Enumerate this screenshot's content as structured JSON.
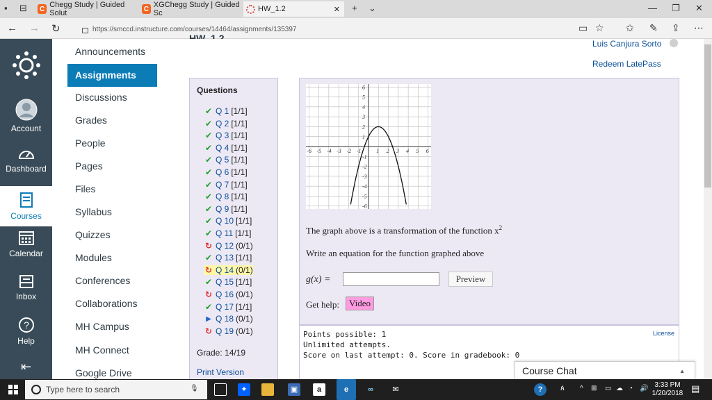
{
  "browser": {
    "tabs": [
      {
        "title": "Chegg Study | Guided Solut",
        "icon": "chegg-icon"
      },
      {
        "title": "XGChegg Study | Guided Sc",
        "icon": "chegg-icon"
      },
      {
        "title": "HW_1.2",
        "icon": "loading-ring-icon"
      }
    ],
    "url": "https://smccd.instructure.com/courses/14464/assignments/135397"
  },
  "global_nav": [
    {
      "label": "",
      "icon": "canvas-logo-icon"
    },
    {
      "label": "Account",
      "icon": "avatar-icon"
    },
    {
      "label": "Dashboard",
      "icon": "dashboard-icon"
    },
    {
      "label": "Courses",
      "icon": "courses-icon"
    },
    {
      "label": "Calendar",
      "icon": "calendar-icon"
    },
    {
      "label": "Inbox",
      "icon": "inbox-icon"
    },
    {
      "label": "Help",
      "icon": "help-icon"
    }
  ],
  "course_nav": {
    "active": "Assignments",
    "items": [
      "Announcements",
      "Discussions",
      "Grades",
      "People",
      "Pages",
      "Files",
      "Syllabus",
      "Quizzes",
      "Modules",
      "Conferences",
      "Collaborations",
      "MH Campus",
      "MH Connect",
      "Google Drive"
    ]
  },
  "page": {
    "title": "HW_1.2",
    "user": "Luis Canjura Sorto",
    "redeem": "Redeem LatePass"
  },
  "questions": {
    "header": "Questions",
    "items": [
      {
        "label": "Q 1",
        "score": "[1/1]",
        "status": "ok"
      },
      {
        "label": "Q 2",
        "score": "[1/1]",
        "status": "ok"
      },
      {
        "label": "Q 3",
        "score": "[1/1]",
        "status": "ok"
      },
      {
        "label": "Q 4",
        "score": "[1/1]",
        "status": "ok"
      },
      {
        "label": "Q 5",
        "score": "[1/1]",
        "status": "ok"
      },
      {
        "label": "Q 6",
        "score": "[1/1]",
        "status": "ok"
      },
      {
        "label": "Q 7",
        "score": "[1/1]",
        "status": "ok"
      },
      {
        "label": "Q 8",
        "score": "[1/1]",
        "status": "ok"
      },
      {
        "label": "Q 9",
        "score": "[1/1]",
        "status": "ok"
      },
      {
        "label": "Q 10",
        "score": "[1/1]",
        "status": "ok"
      },
      {
        "label": "Q 11",
        "score": "[1/1]",
        "status": "ok"
      },
      {
        "label": "Q 12",
        "score": "(0/1)",
        "status": "retry"
      },
      {
        "label": "Q 13",
        "score": "[1/1]",
        "status": "ok"
      },
      {
        "label": "Q 14",
        "score": "(0/1)",
        "status": "retry-current"
      },
      {
        "label": "Q 15",
        "score": "[1/1]",
        "status": "ok"
      },
      {
        "label": "Q 16",
        "score": "(0/1)",
        "status": "retry"
      },
      {
        "label": "Q 17",
        "score": "[1/1]",
        "status": "ok"
      },
      {
        "label": "Q 18",
        "score": "(0/1)",
        "status": "unattempted"
      },
      {
        "label": "Q 19",
        "score": "(0/1)",
        "status": "retry"
      }
    ],
    "grade": "Grade: 14/19",
    "print": "Print Version"
  },
  "problem": {
    "graph_ticks_x": [
      "-6",
      "-5",
      "-4",
      "-3",
      "-2",
      "-1",
      "1",
      "2",
      "3",
      "4",
      "5",
      "6"
    ],
    "graph_ticks_y": [
      "6",
      "5",
      "4",
      "3",
      "2",
      "1",
      "-1",
      "-2",
      "-3",
      "-4",
      "-5",
      "-6"
    ],
    "parabola": {
      "vertex": [
        1,
        2
      ],
      "a": -1
    },
    "prompt1": "The graph above is a transformation of the function x",
    "prompt1_exp": "2",
    "prompt2": "Write an equation for the function graphed above",
    "g_label": "g(x) =",
    "input_value": "",
    "preview": "Preview",
    "get_help": "Get help:",
    "video": "Video"
  },
  "info": {
    "points": "Points possible: 1",
    "attempts": "Unlimited attempts.",
    "last": "Score on last attempt: 0. Score in gradebook: 0",
    "license": "License"
  },
  "chat": "Course Chat",
  "taskbar": {
    "search": "Type here to search",
    "time": "3:33 PM",
    "date": "1/20/2018"
  }
}
